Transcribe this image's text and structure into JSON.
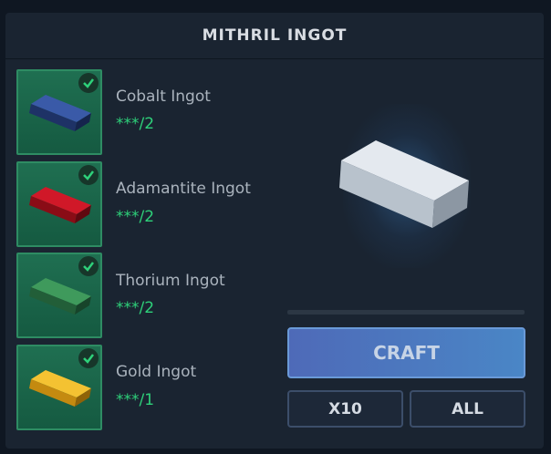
{
  "recipe": {
    "title": "MITHRIL INGOT",
    "ingredients": [
      {
        "name": "Cobalt Ingot",
        "count": "***/2",
        "icon": "cobalt-ingot-icon",
        "color": "#2a3f7a"
      },
      {
        "name": "Adamantite Ingot",
        "count": "***/2",
        "icon": "adamantite-ingot-icon",
        "color": "#b0101c"
      },
      {
        "name": "Thorium Ingot",
        "count": "***/2",
        "icon": "thorium-ingot-icon",
        "color": "#2f7a4a"
      },
      {
        "name": "Gold Ingot",
        "count": "***/1",
        "icon": "gold-ingot-icon",
        "color": "#e8b020"
      }
    ],
    "result_icon": "mithril-ingot-icon",
    "progress": 0
  },
  "actions": {
    "craft_label": "CRAFT",
    "x10_label": "X10",
    "all_label": "ALL"
  },
  "colors": {
    "accent_green": "#2ed17a",
    "craft_blue": "#4a7cc2",
    "panel_bg": "#1a2431"
  }
}
